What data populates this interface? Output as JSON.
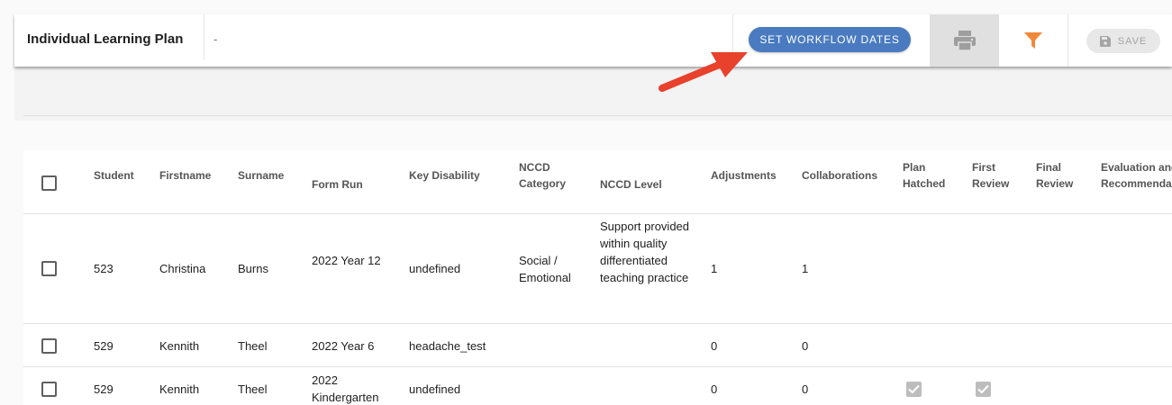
{
  "header": {
    "title": "Individual Learning Plan",
    "subtitle": "-",
    "workflow_button": "SET WORKFLOW DATES",
    "print_icon": "print-icon",
    "filter_icon": "filter-icon",
    "save_button": "SAVE",
    "save_icon": "floppy-disk-icon"
  },
  "colors": {
    "accent": "#4a7bc0",
    "filter": "#f0883a",
    "arrow": "#e8412c"
  },
  "table": {
    "columns": [
      "Student",
      "Firstname",
      "Surname",
      "Form Run",
      "Key Disability",
      "NCCD Category",
      "NCCD Level",
      "Adjustments",
      "Collaborations",
      "Plan Hatched",
      "First Review",
      "Final Review",
      "Evaluation and Recommenda"
    ],
    "rows": [
      {
        "student": "523",
        "firstname": "Christina",
        "surname": "Burns",
        "form_run": "2022 Year 12",
        "key_disability": "undefined",
        "nccd_category": "Social / Emotional",
        "nccd_level": "Support provided within quality differentiated teaching practice",
        "adjustments": "1",
        "collaborations": "1"
      },
      {
        "student": "529",
        "firstname": "Kennith",
        "surname": "Theel",
        "form_run": "2022 Year 6",
        "key_disability": "headache_test",
        "nccd_category": "",
        "nccd_level": "",
        "adjustments": "0",
        "collaborations": "0"
      },
      {
        "student": "529",
        "firstname": "Kennith",
        "surname": "Theel",
        "form_run": "2022 Kindergarten",
        "key_disability": "undefined",
        "nccd_category": "",
        "nccd_level": "",
        "adjustments": "0",
        "collaborations": "0",
        "plan_hatched": true,
        "first_review": true
      }
    ]
  }
}
